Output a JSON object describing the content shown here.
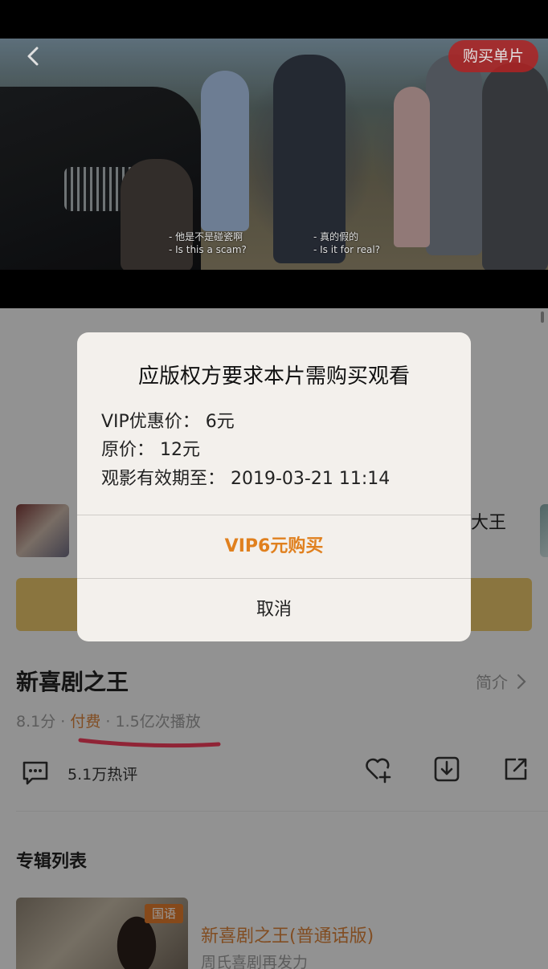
{
  "video": {
    "buy_single_label": "购买单片",
    "subtitle_left_cn": "- 他是不是碰瓷啊",
    "subtitle_left_en": "- Is this a scam?",
    "subtitle_right_cn": "- 真的假的",
    "subtitle_right_en": "- Is it for real?"
  },
  "episode": {
    "partial_title": "-大王"
  },
  "show": {
    "title": "新喜剧之王",
    "intro_label": "简介",
    "rating": "8.1分",
    "sep1": "·",
    "paid_label": "付费",
    "sep2": "·",
    "plays": "1.5亿次播放",
    "comments_label": "5.1万热评"
  },
  "album": {
    "section_title": "专辑列表",
    "badge": "国语",
    "item_title": "新喜剧之王(普通话版)",
    "item_subtitle": "周氏喜剧再发力"
  },
  "dialog": {
    "title": "应版权方要求本片需购买观看",
    "vip_price": "VIP优惠价：  6元",
    "original_price": "原价：  12元",
    "valid_until": "观影有效期至：  2019-03-21 11:14",
    "buy_button": "VIP6元购买",
    "cancel_button": "取消"
  },
  "colors": {
    "accent_orange": "#e0801e",
    "vip_gold": "#e6c36a",
    "buy_badge_red": "#c82828",
    "annotation_red": "#f03c5a"
  }
}
